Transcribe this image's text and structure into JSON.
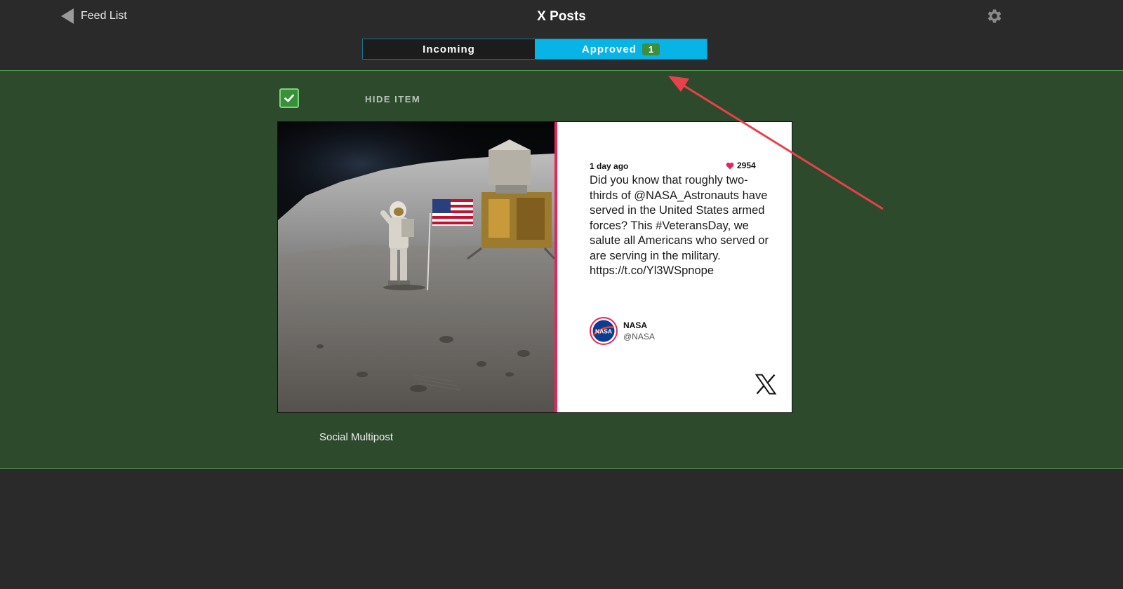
{
  "header": {
    "back_label": "Feed List",
    "title": "X Posts"
  },
  "tabs": [
    {
      "label": "Incoming",
      "active": false
    },
    {
      "label": "Approved",
      "active": true,
      "badge": "1"
    }
  ],
  "item": {
    "hide_label": "HIDE ITEM",
    "hide_checked": true,
    "caption": "Social Multipost"
  },
  "post": {
    "age": "1 day ago",
    "likes": "2954",
    "text": "Did you know that roughly two-thirds of @NASA_Astronauts have served in the United States armed forces? This #VeteransDay, we salute all Americans who served or are serving in the military. https://t.co/Yl3WSpnope",
    "author_name": "NASA",
    "author_handle": "@NASA",
    "avatar_text": "NASA"
  },
  "colors": {
    "accent_tab": "#08b4e6",
    "badge": "#3e8e3e",
    "content_bg": "#2d4a2d",
    "divider": "#e8245a",
    "heart": "#e8245a",
    "annotation_arrow": "#e8414a"
  },
  "icons": [
    "back-arrow-icon",
    "gear-icon",
    "checkmark-icon",
    "heart-icon",
    "x-logo-icon",
    "annotation-arrow"
  ]
}
